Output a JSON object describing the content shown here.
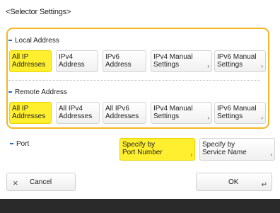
{
  "title": "<Selector Settings>",
  "local": {
    "heading": "Local Address",
    "options": [
      {
        "label": "All IP\nAddresses"
      },
      {
        "label": "IPv4\nAddress"
      },
      {
        "label": "IPv6\nAddress"
      },
      {
        "label": "IPv4 Manual\nSettings",
        "arrow": "›"
      },
      {
        "label": "IPv6 Manual\nSettings",
        "arrow": "›"
      }
    ],
    "selected_index": 0
  },
  "remote": {
    "heading": "Remote Address",
    "options": [
      {
        "label": "All IP\nAddresses"
      },
      {
        "label": "All IPv4\nAddresses"
      },
      {
        "label": "All IPv6\nAddresses"
      },
      {
        "label": "IPv4 Manual\nSettings",
        "arrow": "›"
      },
      {
        "label": "IPv6 Manual\nSettings",
        "arrow": "›"
      }
    ],
    "selected_index": 0
  },
  "port": {
    "heading": "Port",
    "options": [
      {
        "label": "Specify by\nPort Number",
        "arrow": "›"
      },
      {
        "label": "Specify by\nService Name",
        "arrow": "›"
      }
    ],
    "selected_index": 0
  },
  "buttons": {
    "cancel_icon": "×",
    "cancel_label": "Cancel",
    "ok_label": "OK",
    "ok_icon": "↵"
  },
  "colors": {
    "selected": "#ffef2f",
    "group_border": "#f4b724",
    "accent": "#1a6fc9"
  }
}
